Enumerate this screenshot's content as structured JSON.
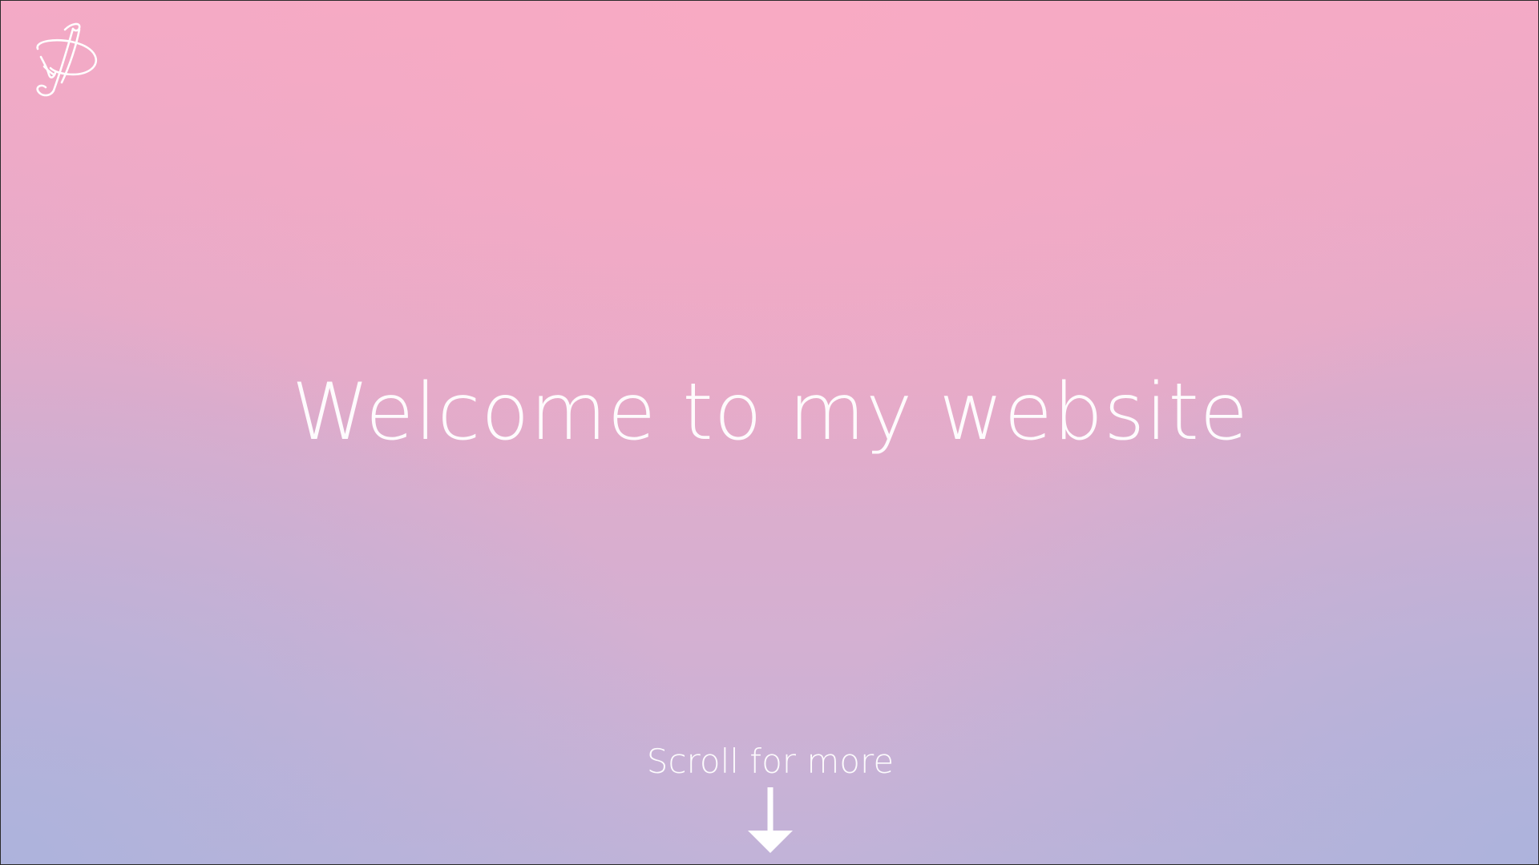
{
  "page": {
    "headline": "Welcome to my website",
    "scroll_label": "Scroll for more",
    "logo_icon": "signature-logo-icon",
    "arrow_icon": "arrow-down-icon"
  },
  "colors": {
    "top": "#f8aac3",
    "bottom_corners": "#adb3dc",
    "text": "#ffffff"
  }
}
